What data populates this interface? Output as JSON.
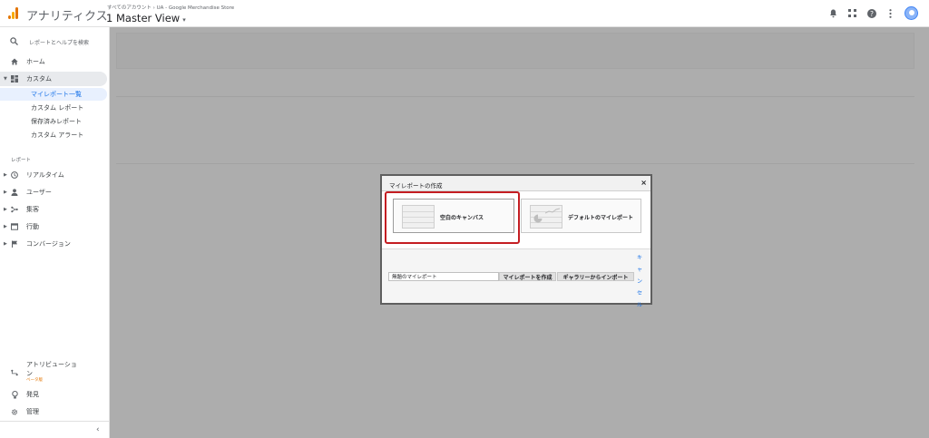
{
  "header": {
    "app_title": "アナリティクス",
    "account_path": "すべてのアカウント › UA - Google Merchandise Store",
    "view_name": "1 Master View",
    "icons": [
      "bell-icon",
      "apps-grid-icon",
      "help-icon",
      "more-vert-icon",
      "avatar"
    ]
  },
  "sidebar": {
    "search_label": "レポートとヘルプを検索",
    "home_label": "ホーム",
    "custom_label": "カスタム",
    "custom_items": [
      {
        "label": "マイレポート一覧"
      },
      {
        "label": "カスタム レポート"
      },
      {
        "label": "保存済みレポート"
      },
      {
        "label": "カスタム アラート"
      }
    ],
    "reports_section": "レポート",
    "report_items": [
      {
        "label": "リアルタイム"
      },
      {
        "label": "ユーザー"
      },
      {
        "label": "集客"
      },
      {
        "label": "行動"
      },
      {
        "label": "コンバージョン"
      }
    ],
    "attribution_line1": "アトリビューショ",
    "attribution_line2": "ン",
    "attribution_badge": "ベータ版",
    "discover_label": "発見",
    "admin_label": "管理",
    "collapse_icon": "‹"
  },
  "dialog": {
    "title": "マイレポートの作成",
    "close": "×",
    "option_blank": "空白のキャンバス",
    "option_default": "デフォルトのマイレポート",
    "name_value": "無題のマイレポート",
    "create_button": "マイレポートを作成",
    "import_button": "ギャラリーからインポート",
    "cancel": "キャンセル",
    "highlight_color": "#c41d22"
  },
  "colors": {
    "overlay": "#adadad",
    "accent": "#1a73e8",
    "logo_orange": "#e37400",
    "logo_yellow": "#f9ab00"
  }
}
